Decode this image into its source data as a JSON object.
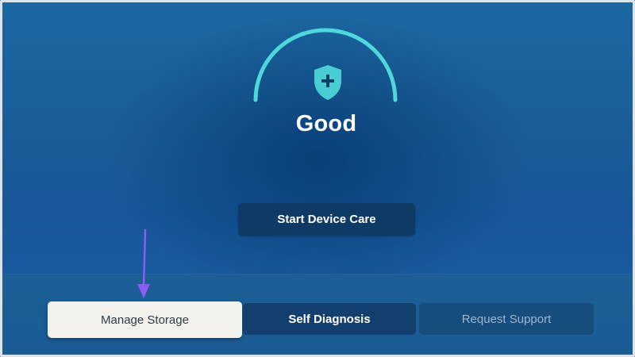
{
  "device_care": {
    "status_label": "Good",
    "start_button_label": "Start Device Care"
  },
  "menu": {
    "items": [
      {
        "label": "Manage Storage",
        "state": "focused"
      },
      {
        "label": "Self Diagnosis",
        "state": "normal"
      },
      {
        "label": "Request Support",
        "state": "dimmed"
      }
    ]
  },
  "colors": {
    "gauge_arc": "#4fd8dc",
    "shield": "#48cdd3",
    "annotation_arrow": "#8b5cf6",
    "focused_button": "#f2f1ec"
  },
  "icons": {
    "status": "shield-plus-icon",
    "annotation": "arrow-down-icon"
  }
}
